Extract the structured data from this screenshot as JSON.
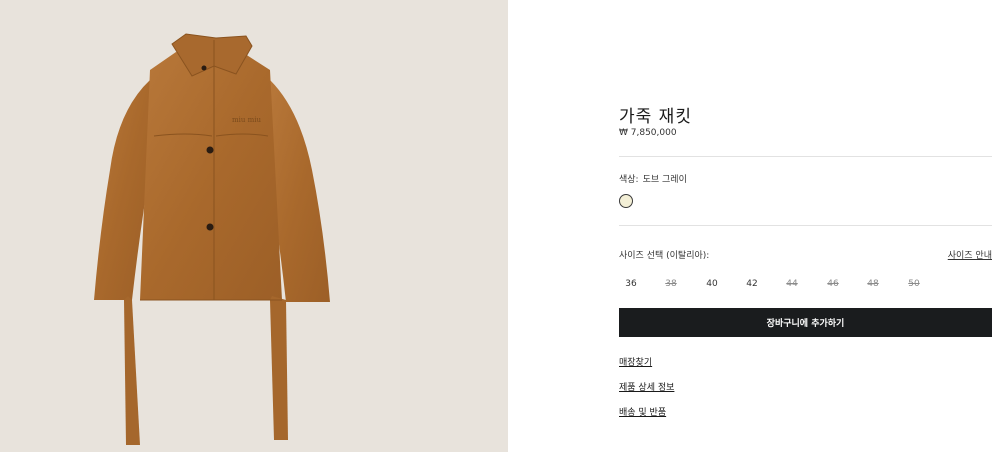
{
  "product": {
    "image_alt": "suede-jacket-image",
    "jacket_logo": "miu miu",
    "title": "가죽 재킷",
    "price": "₩ 7,850,000"
  },
  "color": {
    "label": "색상:",
    "value": "도브 그레이",
    "swatch_color": "#f3efd6"
  },
  "size": {
    "label": "사이즈 선택 (이탈리아):",
    "guide_label": "사이즈 안내",
    "options": [
      {
        "label": "36",
        "available": true
      },
      {
        "label": "38",
        "available": false
      },
      {
        "label": "40",
        "available": true
      },
      {
        "label": "42",
        "available": true
      },
      {
        "label": "44",
        "available": false
      },
      {
        "label": "46",
        "available": false
      },
      {
        "label": "48",
        "available": false
      },
      {
        "label": "50",
        "available": false
      }
    ]
  },
  "actions": {
    "add_to_cart": "장바구니에 추가하기"
  },
  "links": {
    "store_finder": "매장찾기",
    "product_details": "제품 상세 정보",
    "shipping_returns": "배송 및 반품"
  },
  "colors": {
    "background_image": "#e8e3dc",
    "jacket": "#b07232",
    "button_bg": "#1a1c1e",
    "button_text": "#ffffff"
  }
}
